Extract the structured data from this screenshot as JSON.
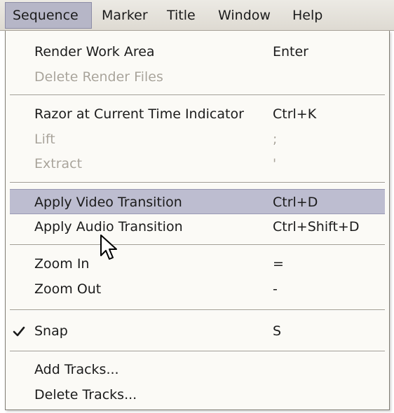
{
  "menubar": {
    "items": [
      {
        "label": "Sequence",
        "active": true
      },
      {
        "label": "Marker"
      },
      {
        "label": "Title"
      },
      {
        "label": "Window"
      },
      {
        "label": "Help"
      }
    ]
  },
  "menu": {
    "render_work_area": {
      "label": "Render Work Area",
      "shortcut": "Enter"
    },
    "delete_render_files": {
      "label": "Delete Render Files",
      "disabled": true
    },
    "razor": {
      "label": "Razor at Current Time Indicator",
      "shortcut": "Ctrl+K"
    },
    "lift": {
      "label": "Lift",
      "shortcut": ";",
      "disabled": true
    },
    "extract": {
      "label": "Extract",
      "shortcut": "'",
      "disabled": true
    },
    "apply_video_transition": {
      "label": "Apply Video Transition",
      "shortcut": "Ctrl+D",
      "highlighted": true
    },
    "apply_audio_transition": {
      "label": "Apply Audio Transition",
      "shortcut": "Ctrl+Shift+D"
    },
    "zoom_in": {
      "label": "Zoom In",
      "shortcut": "="
    },
    "zoom_out": {
      "label": "Zoom Out",
      "shortcut": "-"
    },
    "snap": {
      "label": "Snap",
      "shortcut": "S",
      "checked": true
    },
    "add_tracks": {
      "label": "Add Tracks..."
    },
    "delete_tracks": {
      "label": "Delete Tracks..."
    }
  },
  "icons": {
    "check": "check-icon",
    "cursor": "mouse-pointer-icon"
  },
  "colors": {
    "highlight": "#bdbdd0",
    "disabled_text": "#a9a49a",
    "menu_bg": "#fbfaf6",
    "menubar_bg": "#e4e1da"
  }
}
